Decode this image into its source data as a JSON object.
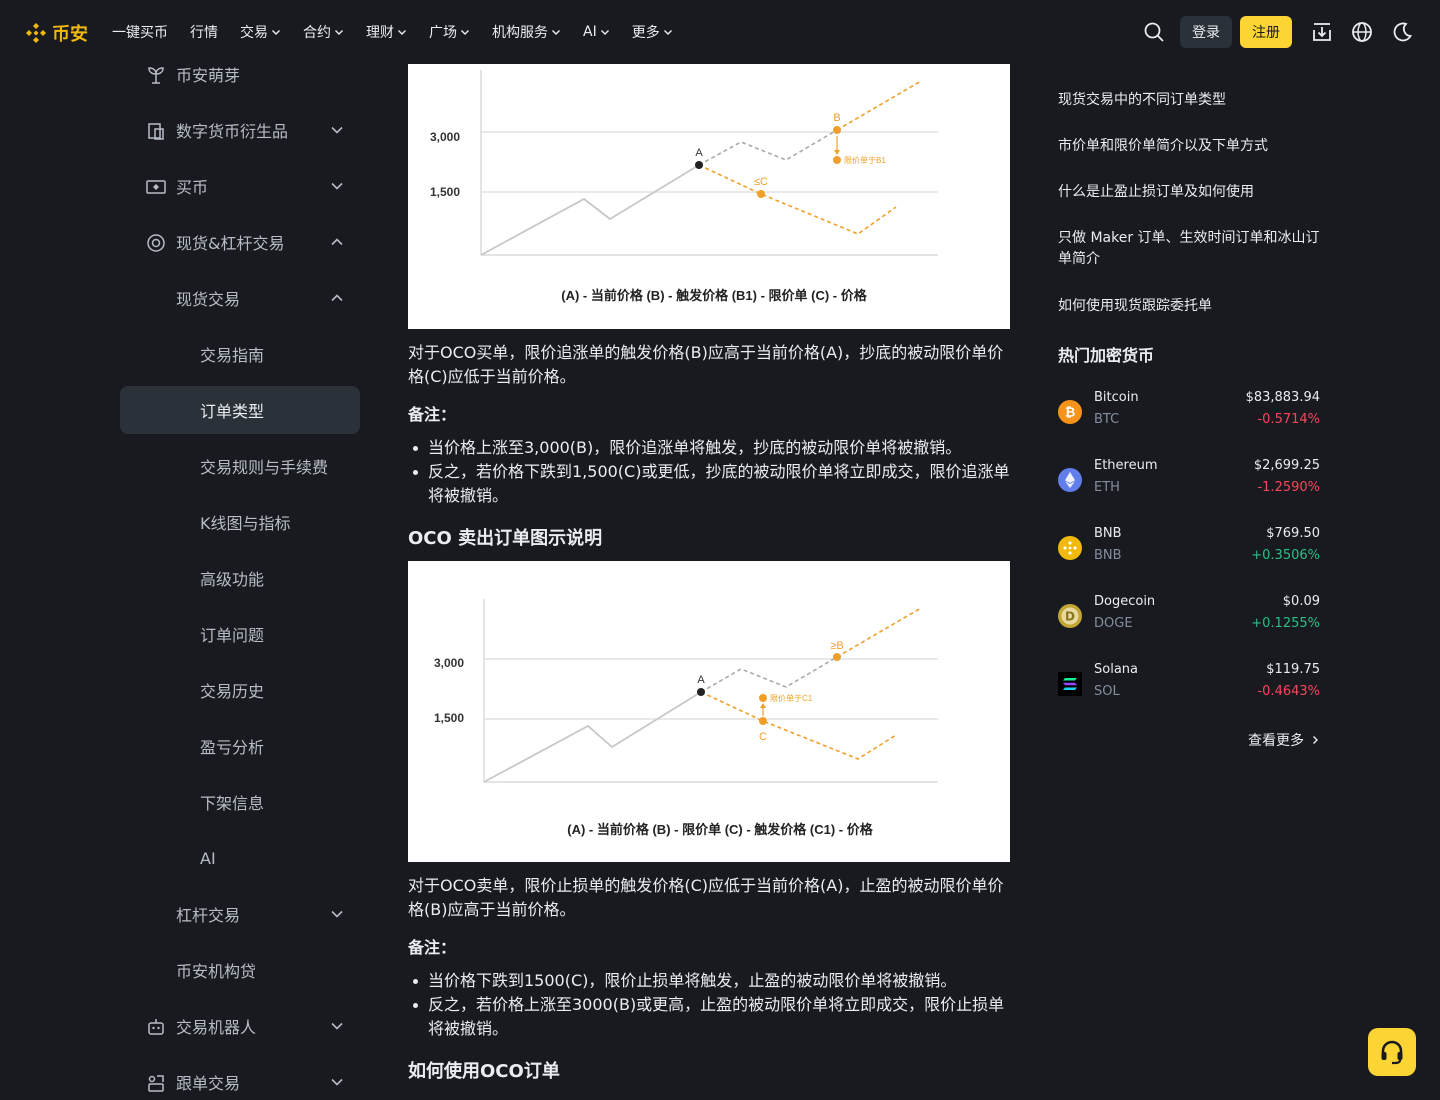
{
  "header": {
    "logo_text": "币安",
    "nav": [
      {
        "label": "一键买币",
        "dropdown": false
      },
      {
        "label": "行情",
        "dropdown": false
      },
      {
        "label": "交易",
        "dropdown": true
      },
      {
        "label": "合约",
        "dropdown": true
      },
      {
        "label": "理财",
        "dropdown": true
      },
      {
        "label": "广场",
        "dropdown": true
      },
      {
        "label": "机构服务",
        "dropdown": true
      },
      {
        "label": "AI",
        "dropdown": true
      },
      {
        "label": "更多",
        "dropdown": true
      }
    ],
    "login_label": "登录",
    "register_label": "注册",
    "icons": [
      "search-icon",
      "download-icon",
      "globe-icon",
      "moon-icon"
    ]
  },
  "sidebar": {
    "items": [
      {
        "label": "币安萌芽",
        "icon": "sprout-icon",
        "expand": null
      },
      {
        "label": "数字货币衍生品",
        "icon": "derivatives-icon",
        "expand": "down"
      },
      {
        "label": "买币",
        "icon": "buy-crypto-icon",
        "expand": "down"
      },
      {
        "label": "现货&杠杆交易",
        "icon": "spot-margin-icon",
        "expand": "up"
      },
      {
        "label": "现货交易",
        "icon": null,
        "expand": "up"
      },
      {
        "label": "交易指南",
        "icon": null,
        "expand": null
      },
      {
        "label": "订单类型",
        "icon": null,
        "expand": null,
        "active": true
      },
      {
        "label": "交易规则与手续费",
        "icon": null,
        "expand": null
      },
      {
        "label": "K线图与指标",
        "icon": null,
        "expand": null
      },
      {
        "label": "高级功能",
        "icon": null,
        "expand": null
      },
      {
        "label": "订单问题",
        "icon": null,
        "expand": null
      },
      {
        "label": "交易历史",
        "icon": null,
        "expand": null
      },
      {
        "label": "盈亏分析",
        "icon": null,
        "expand": null
      },
      {
        "label": "下架信息",
        "icon": null,
        "expand": null
      },
      {
        "label": "AI",
        "icon": null,
        "expand": null
      },
      {
        "label": "杠杆交易",
        "icon": null,
        "expand": "down"
      },
      {
        "label": "币安机构贷",
        "icon": null,
        "expand": null
      },
      {
        "label": "交易机器人",
        "icon": "bot-icon",
        "expand": "down"
      },
      {
        "label": "跟单交易",
        "icon": "copy-trading-icon",
        "expand": "down"
      }
    ]
  },
  "article": {
    "chart1": {
      "y_ticks": [
        "3,000",
        "1,500"
      ],
      "labels": {
        "a": "A",
        "b": "B",
        "c": "≤C",
        "note": "限价单于B1"
      },
      "caption": "(A) - 当前价格  (B) - 触发价格  (B1) - 限价单  (C) - 价格"
    },
    "para1": "对于OCO买单，限价追涨单的触发价格(B)应高于当前价格(A)，抄底的被动限价单价格(C)应低于当前价格。",
    "note1_title": "备注：",
    "bullets1": [
      "当价格上涨至3,000(B)，限价追涨单将触发，抄底的被动限价单将被撤销。",
      "反之，若价格下跌到1,500(C)或更低，抄底的被动限价单将立即成交，限价追涨单将被撤销。"
    ],
    "h_sell": "OCO 卖出订单图示说明",
    "chart2": {
      "y_ticks": [
        "3,000",
        "1,500"
      ],
      "labels": {
        "a": "A",
        "b": "≥B",
        "c": "C",
        "note": "限价单于C1"
      },
      "caption": "(A) - 当前价格  (B) - 限价单  (C) - 触发价格 (C1) - 价格"
    },
    "para2": "对于OCO卖单，限价止损单的触发价格(C)应低于当前价格(A)，止盈的被动限价单价格(B)应高于当前价格。",
    "note2_title": "备注：",
    "bullets2": [
      "当价格下跌到1500(C)，限价止损单将触发，止盈的被动限价单将被撤销。",
      "反之，若价格上涨至3000(B)或更高，止盈的被动限价单将立即成交，限价止损单将被撤销。"
    ],
    "h_howto": "如何使用OCO订单"
  },
  "right": {
    "toc": [
      "现货交易中的不同订单类型",
      "市价单和限价单简介以及下单方式",
      "什么是止盈止损订单及如何使用",
      "只做 Maker 订单、生效时间订单和冰山订单简介",
      "如何使用现货跟踪委托单"
    ],
    "hot_title": "热门加密货币",
    "coins": [
      {
        "name": "Bitcoin",
        "symbol": "BTC",
        "price": "$83,883.94",
        "change": "-0.5714%",
        "dir": "down",
        "icon": "bitcoin-icon",
        "color": "#f7931a"
      },
      {
        "name": "Ethereum",
        "symbol": "ETH",
        "price": "$2,699.25",
        "change": "-1.2590%",
        "dir": "down",
        "icon": "ethereum-icon",
        "color": "#627eea"
      },
      {
        "name": "BNB",
        "symbol": "BNB",
        "price": "$769.50",
        "change": "+0.3506%",
        "dir": "up",
        "icon": "bnb-icon",
        "color": "#f0b90b"
      },
      {
        "name": "Dogecoin",
        "symbol": "DOGE",
        "price": "$0.09",
        "change": "+0.1255%",
        "dir": "up",
        "icon": "dogecoin-icon",
        "color": "#c2a633"
      },
      {
        "name": "Solana",
        "symbol": "SOL",
        "price": "$119.75",
        "change": "-0.4643%",
        "dir": "down",
        "icon": "solana-icon",
        "color": "#000000"
      }
    ],
    "more_label": "查看更多"
  },
  "colors": {
    "up": "#2ebd85",
    "down": "#f6465d",
    "brand": "#f0b90b"
  }
}
